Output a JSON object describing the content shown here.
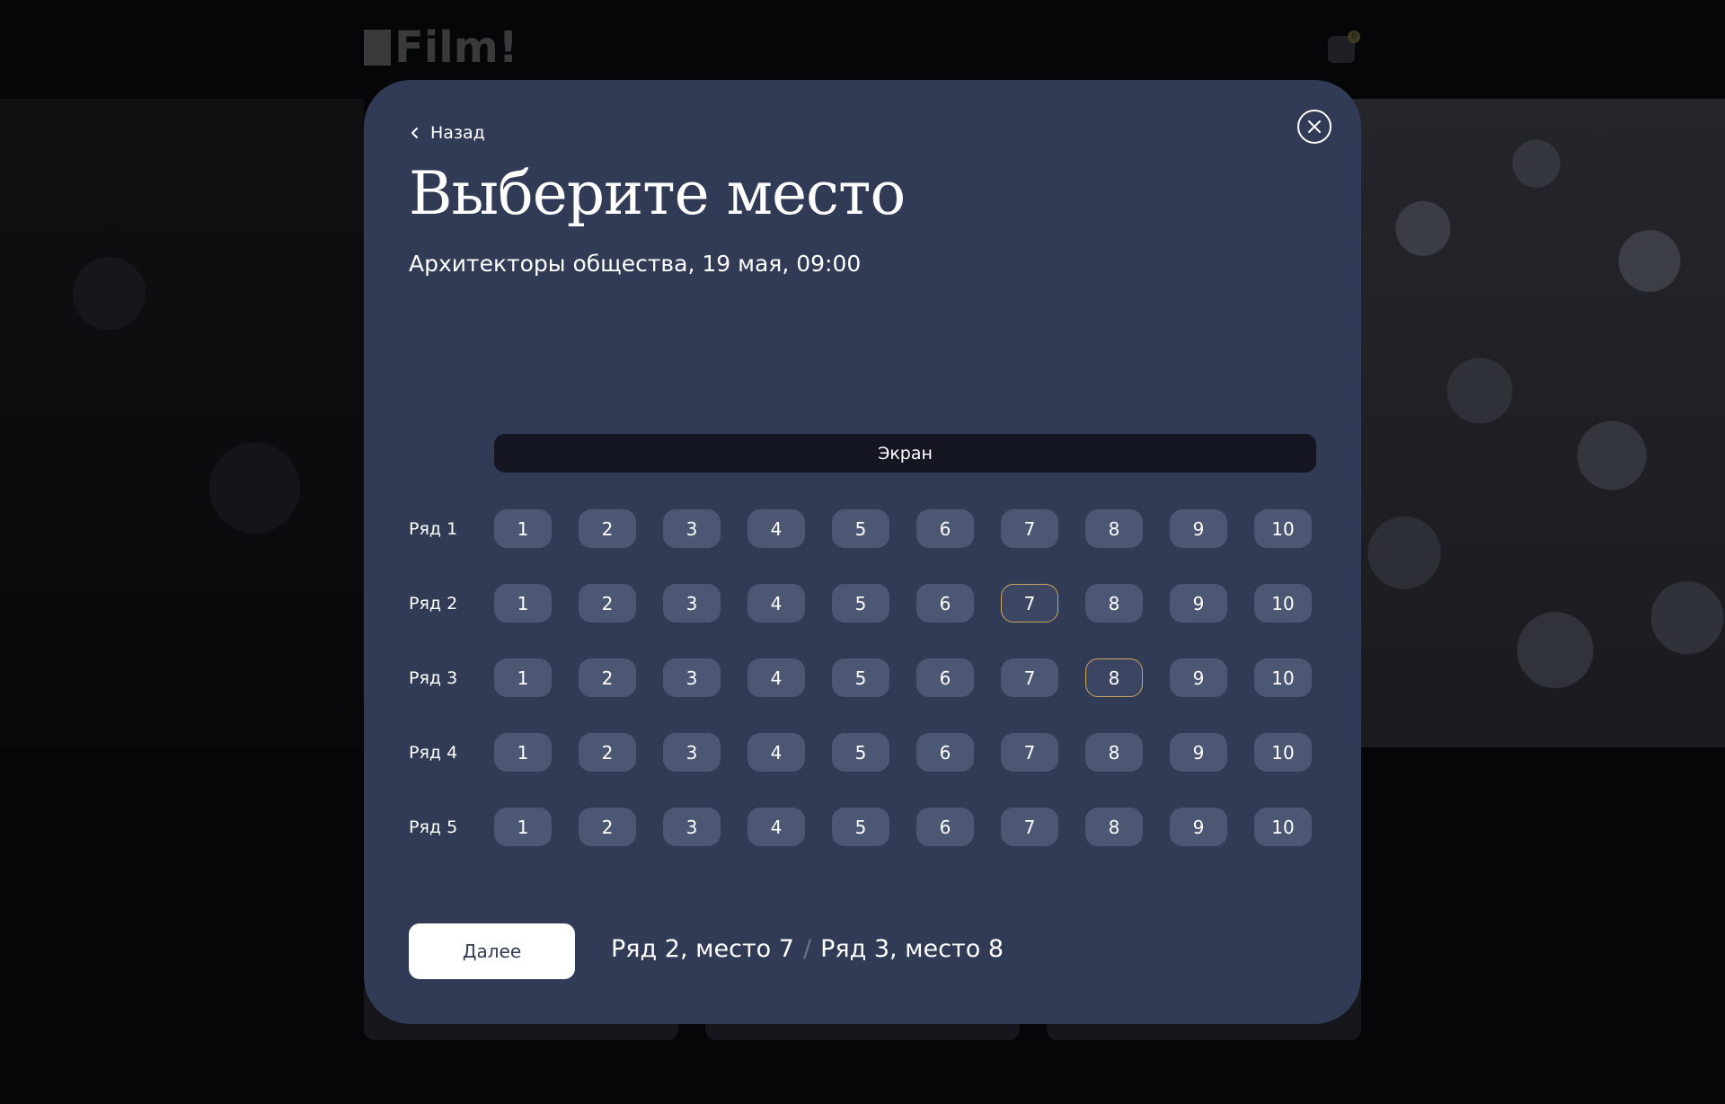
{
  "background": {
    "logo_text": "Film!",
    "cart_count": "0"
  },
  "modal": {
    "back_label": "Назад",
    "title": "Выберите место",
    "subtitle": "Архитекторы общества, 19 мая, 09:00",
    "screen_label": "Экран",
    "rows": [
      {
        "label": "Ряд 1",
        "seats": [
          "1",
          "2",
          "3",
          "4",
          "5",
          "6",
          "7",
          "8",
          "9",
          "10"
        ]
      },
      {
        "label": "Ряд 2",
        "seats": [
          "1",
          "2",
          "3",
          "4",
          "5",
          "6",
          "7",
          "8",
          "9",
          "10"
        ]
      },
      {
        "label": "Ряд 3",
        "seats": [
          "1",
          "2",
          "3",
          "4",
          "5",
          "6",
          "7",
          "8",
          "9",
          "10"
        ]
      },
      {
        "label": "Ряд 4",
        "seats": [
          "1",
          "2",
          "3",
          "4",
          "5",
          "6",
          "7",
          "8",
          "9",
          "10"
        ]
      },
      {
        "label": "Ряд 5",
        "seats": [
          "1",
          "2",
          "3",
          "4",
          "5",
          "6",
          "7",
          "8",
          "9",
          "10"
        ]
      }
    ],
    "selected_seats": [
      {
        "row": 2,
        "seat": 7
      },
      {
        "row": 3,
        "seat": 8
      }
    ],
    "next_button_label": "Далее",
    "summary": {
      "first": "Ряд 2, место 7",
      "separator": "/",
      "second": "Ряд 3, место 8"
    },
    "colors": {
      "modal_bg": "#323b55",
      "seat_bg": "#4c5774",
      "selected_border": "#c9a45a",
      "screen_bg": "#141722"
    }
  }
}
